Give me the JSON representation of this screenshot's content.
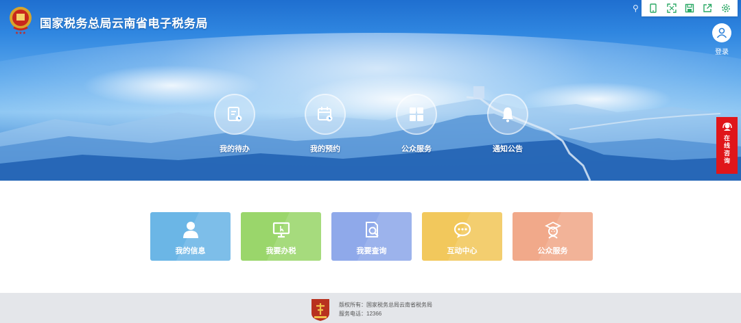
{
  "header": {
    "logo_icon": "tax-emblem-icon",
    "title": "国家税务总局云南省电子税务局"
  },
  "toolbar": {
    "items": [
      {
        "icon": "mobile-icon"
      },
      {
        "icon": "fullscreen-icon"
      },
      {
        "icon": "save-icon"
      },
      {
        "icon": "share-icon"
      },
      {
        "icon": "settings-icon"
      }
    ]
  },
  "login": {
    "label": "登录",
    "icon": "user-avatar-icon"
  },
  "hero_nav": [
    {
      "label": "我的待办",
      "icon": "todo-icon"
    },
    {
      "label": "我的预约",
      "icon": "calendar-icon"
    },
    {
      "label": "公众服务",
      "icon": "grid-icon"
    },
    {
      "label": "通知公告",
      "icon": "bell-icon"
    }
  ],
  "consult": {
    "chars": [
      "在",
      "线",
      "咨",
      "询"
    ],
    "icon": "headset-icon"
  },
  "cards": [
    {
      "label": "我的信息",
      "icon": "user-icon",
      "color": "#6bb6e6"
    },
    {
      "label": "我要办税",
      "icon": "monitor-icon",
      "color": "#9ad66b"
    },
    {
      "label": "我要查询",
      "icon": "search-doc-icon",
      "color": "#8fa9ea"
    },
    {
      "label": "互动中心",
      "icon": "chat-icon",
      "color": "#f2c85c"
    },
    {
      "label": "公众服务",
      "icon": "student-icon",
      "color": "#f1a98a"
    }
  ],
  "footer": {
    "copyright": "版权所有：国家税务总局云南省税务局",
    "phone": "服务电话：12366"
  },
  "colors": {
    "hero_blue": "#2f86e0",
    "consult_red": "#e0161a",
    "footer_bg": "#e4e6ea"
  }
}
